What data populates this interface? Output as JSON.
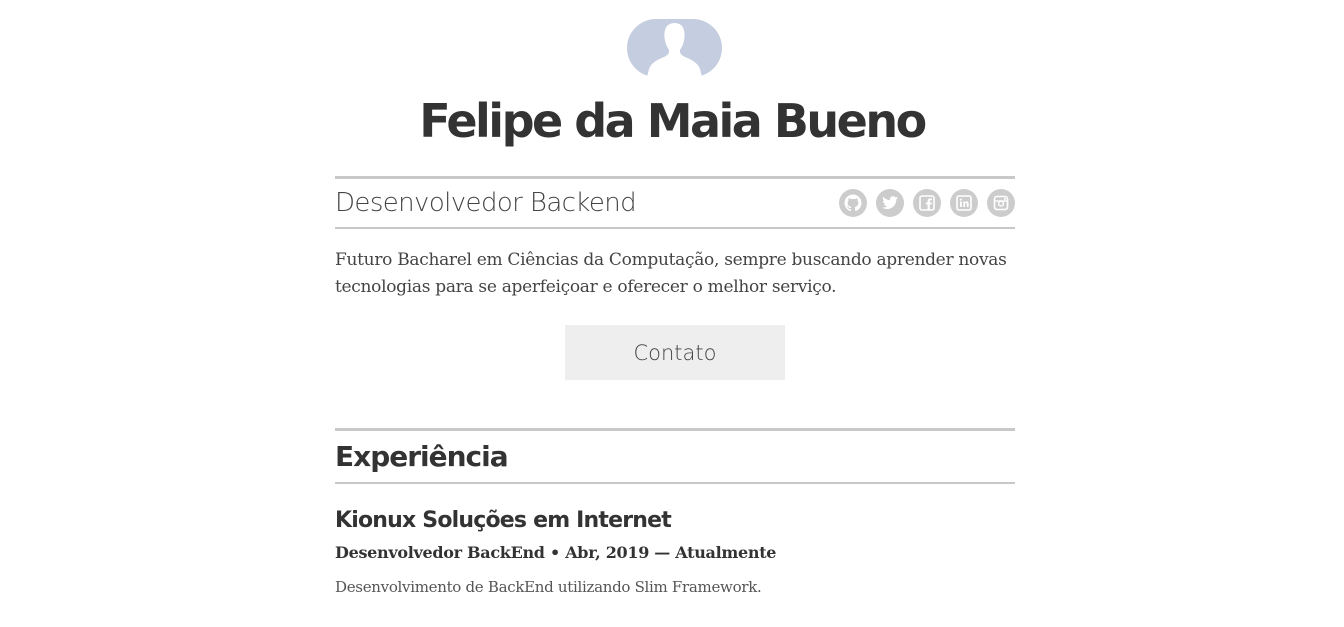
{
  "profile": {
    "name": "Felipe da Maia Bueno",
    "role": "Desenvolvedor Backend",
    "bio": "Futuro Bacharel em Ciências da Computação, sempre buscando aprender novas tecnologias para se aperfeiçoar e oferecer o melhor serviço.",
    "avatar_icon": "user-silhouette-icon"
  },
  "socials": [
    {
      "icon": "github-icon"
    },
    {
      "icon": "twitter-icon"
    },
    {
      "icon": "facebook-icon"
    },
    {
      "icon": "linkedin-icon"
    },
    {
      "icon": "instagram-icon"
    }
  ],
  "contact": {
    "label": "Contato"
  },
  "experience": {
    "section_title": "Experiência",
    "jobs": [
      {
        "company": "Kionux Soluções em Internet",
        "position": "Desenvolvedor BackEnd",
        "period": "Abr, 2019 — Atualmente",
        "description": "Desenvolvimento de BackEnd utilizando Slim Framework."
      }
    ]
  },
  "colors": {
    "text": "#333333",
    "rule": "#c8c8c8",
    "social_bg": "#cccccc",
    "button_bg": "#eeeeee",
    "avatar_bg": "#c5cde0"
  }
}
